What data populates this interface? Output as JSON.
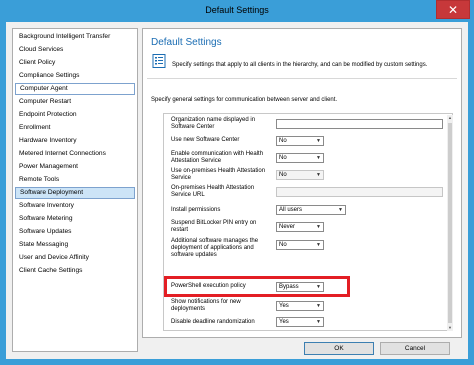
{
  "window": {
    "title": "Default Settings",
    "close_glyph": "✕"
  },
  "sidebar": {
    "items": [
      {
        "label": "Background Intelligent Transfer"
      },
      {
        "label": "Cloud Services"
      },
      {
        "label": "Client Policy"
      },
      {
        "label": "Compliance Settings"
      },
      {
        "label": "Computer Agent"
      },
      {
        "label": "Computer Restart"
      },
      {
        "label": "Endpoint Protection"
      },
      {
        "label": "Enrollment"
      },
      {
        "label": "Hardware Inventory"
      },
      {
        "label": "Metered Internet Connections"
      },
      {
        "label": "Power Management"
      },
      {
        "label": "Remote Tools"
      },
      {
        "label": "Software Deployment"
      },
      {
        "label": "Software Inventory"
      },
      {
        "label": "Software Metering"
      },
      {
        "label": "Software Updates"
      },
      {
        "label": "State Messaging"
      },
      {
        "label": "User and Device Affinity"
      },
      {
        "label": "Client Cache Settings"
      }
    ],
    "selected": "Software Deployment"
  },
  "main": {
    "title": "Default Settings",
    "description": "Specify settings that apply to all clients in the hierarchy, and can be modified by custom settings.",
    "general_description": "Specify general settings for communication between server and client.",
    "settings": [
      {
        "label": "Organization name displayed in Software Center",
        "value": ""
      },
      {
        "label": "Use new Software Center",
        "value": "No"
      },
      {
        "label": "Enable communication with Health Attestation Service",
        "value": "No"
      },
      {
        "label": "Use on-premises Health Attestation Service",
        "value": "No"
      },
      {
        "label": "On-premises Health Attestation Service URL",
        "value": ""
      },
      {
        "label": "Install permissions",
        "value": "All users"
      },
      {
        "label": "Suspend BitLocker PIN entry on restart",
        "value": "Never"
      },
      {
        "label": "Additional software manages the deployment of applications and software updates",
        "value": "No"
      },
      {
        "label": "PowerShell execution policy",
        "value": "Bypass"
      },
      {
        "label": "Show notifications for new deployments",
        "value": "Yes"
      },
      {
        "label": "Disable deadline randomization",
        "value": "Yes"
      }
    ],
    "highlight_color": "#e31e24"
  },
  "buttons": {
    "ok": "OK",
    "cancel": "Cancel"
  },
  "icons": {
    "dropdown_arrow": "▼",
    "scroll_up": "▲",
    "scroll_down": "▼"
  }
}
